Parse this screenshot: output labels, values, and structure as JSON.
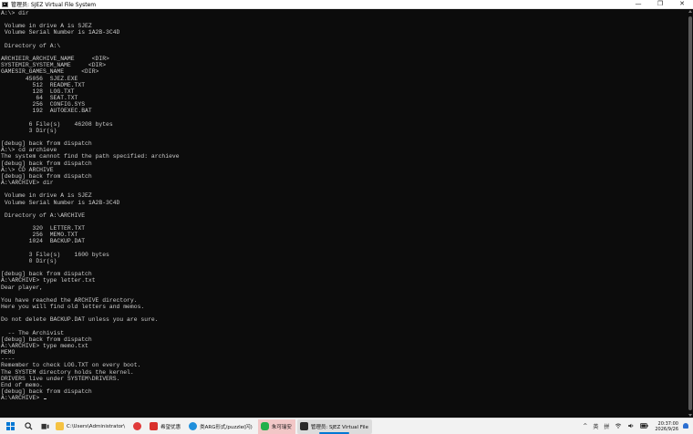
{
  "window": {
    "title": "管理员: SJEZ Virtual File System",
    "minimize_glyph": "—",
    "maximize_glyph": "❐",
    "close_glyph": "✕"
  },
  "console": {
    "lines": [
      "A:\\> dir",
      "",
      " Volume in drive A is SJEZ",
      " Volume Serial Number is 1A2B-3C4D",
      "",
      " Directory of A:\\",
      "",
      "ARCHIEIR_ARCHIVE_NAME     <DIR>",
      "SYSTEMIR_SYSTEM_NAME     <DIR>",
      "GAMESIR_GAMES_NAME     <DIR>",
      "       45056  SJEZ.EXE",
      "         512  README.TXT",
      "         128  LOG.TXT",
      "          64  SEAT.TXT",
      "         256  CONFIG.SYS",
      "         192  AUTOEXEC.BAT",
      "",
      "        6 File(s)    46208 bytes",
      "        3 Dir(s)",
      "",
      "[debug] back from dispatch",
      "A:\\> cd archieve",
      "The system cannot find the path specified: archieve",
      "[debug] back from dispatch",
      "A:\\> CD ARCHIVE",
      "[debug] back from dispatch",
      "A:\\ARCHIVE> dir",
      "",
      " Volume in drive A is SJEZ",
      " Volume Serial Number is 1A2B-3C4D",
      "",
      " Directory of A:\\ARCHIVE",
      "",
      "         320  LETTER.TXT",
      "         256  MEMO.TXT",
      "        1024  BACKUP.DAT",
      "",
      "        3 File(s)    1600 bytes",
      "        0 Dir(s)",
      "",
      "[debug] back from dispatch",
      "A:\\ARCHIVE> type letter.txt",
      "Dear player,",
      "",
      "You have reached the ARCHIVE directory.",
      "Here you will find old letters and memos.",
      "",
      "Do not delete BACKUP.DAT unless you are sure.",
      "",
      "  -- The Archivist",
      "[debug] back from dispatch",
      "A:\\ARCHIVE> type memo.txt",
      "MEMO",
      "----",
      "Remember to check LOG.TXT on every boot.",
      "The SYSTEM directory holds the kernel.",
      "DRIVERS live under SYSTEM\\DRIVERS.",
      "End of memo.",
      "[debug] back from dispatch",
      "A:\\ARCHIVE> "
    ]
  },
  "taskbar": {
    "apps": [
      {
        "label": "C:\\Users\\Administrator\\",
        "icon": "folder-icon",
        "color": "#f5c242"
      },
      {
        "label": "",
        "icon": "netease-music-icon",
        "color": "#e03a3a"
      },
      {
        "label": "希望优惠",
        "icon": "app-red-icon",
        "color": "#d9302b"
      },
      {
        "label": "类ARG形式/puzzle(闪)",
        "icon": "edge-icon",
        "color": "#1f8fdb"
      },
      {
        "label": "朱可瑞安",
        "icon": "wechat-icon",
        "color": "#22b04b"
      },
      {
        "label": "管理员: SJEZ Virtual File",
        "icon": "terminal-icon",
        "color": "#2b2b2b"
      }
    ],
    "tray": {
      "chevron": "^",
      "ime_lang": "英",
      "ime_mode": "拼",
      "time": "20:37:00",
      "date": "2026/9/26"
    }
  }
}
